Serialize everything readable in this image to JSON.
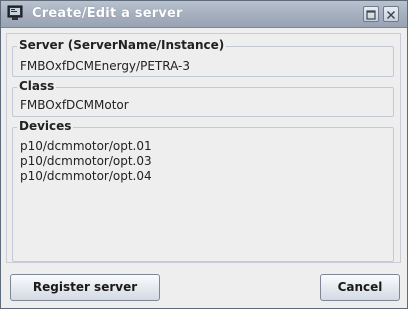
{
  "window": {
    "title": "Create/Edit a server",
    "icon": "computer-terminal-icon",
    "maximize_icon": "maximize-icon",
    "close_icon": "close-icon"
  },
  "server": {
    "label": "Server  (ServerName/Instance)",
    "value": "FMBOxfDCMEnergy/PETRA-3"
  },
  "class": {
    "label": "Class",
    "value": "FMBOxfDCMMotor"
  },
  "devices": {
    "label": "Devices",
    "items": [
      "p10/dcmmotor/opt.01",
      "p10/dcmmotor/opt.03",
      "p10/dcmmotor/opt.04"
    ]
  },
  "buttons": {
    "register": "Register server",
    "cancel": "Cancel"
  }
}
